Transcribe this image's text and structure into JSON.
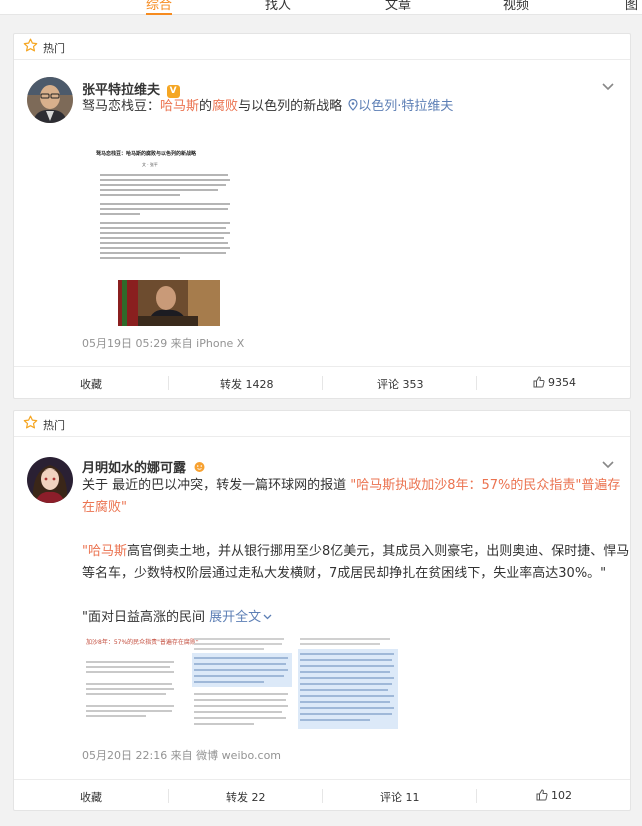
{
  "nav": {
    "tabs": [
      "综合",
      "找人",
      "文章",
      "视频",
      "图"
    ]
  },
  "colors": {
    "accent": "#f68b1f",
    "link_red": "#eb7350",
    "topic_blue": "#5d7fb5",
    "meta_gray": "#939393"
  },
  "posts": [
    {
      "hot_label": "热门",
      "username": "张平特拉维夫",
      "verified_badge": "V",
      "text_prefix": "驽马恋栈豆：",
      "text_kw1": "哈马斯",
      "text_mid": "的",
      "text_kw2": "腐败",
      "text_suffix": "与以色列的新战略",
      "location": "以色列·特拉维夫",
      "image": {
        "title": "驽马恋栈豆：哈马斯的腐败与以色列的新战略",
        "author": "文 · 张平"
      },
      "meta": "05月19日 05:29  来自 iPhone X",
      "actions": {
        "collect": "收藏",
        "repost": "转发 1428",
        "comment": "评论 353",
        "like": "9354"
      }
    },
    {
      "hot_label": "热门",
      "username": "月明如水的娜可露",
      "line1_prefix": "关于 最近的巴以冲突，转发一篇环球网的报道 ",
      "line1_link": "\"哈马斯执政加沙8年：57%的民众指责\"普遍存",
      "line2_link": "在腐败\"",
      "para2_kw": "\"哈马斯",
      "para2_rest": "高官倒卖土地，并从银行挪用至少8亿美元，其成员入则豪宅，出则奥迪、保时捷、悍马",
      "para2_line2": "等名车，少数特权阶层通过走私大发横财，7成居民却挣扎在贫困线下，失业率高达30%。\"",
      "para3_text": "\"面对日益高涨的民间 ",
      "para3_expand": "展开全文",
      "image_title": "加沙8年：57%的民众指责\"普遍存在腐败\"",
      "meta": "05月20日 22:16  来自 微博 weibo.com",
      "actions": {
        "collect": "收藏",
        "repost": "转发 22",
        "comment": "评论 11",
        "like": "102"
      }
    }
  ]
}
